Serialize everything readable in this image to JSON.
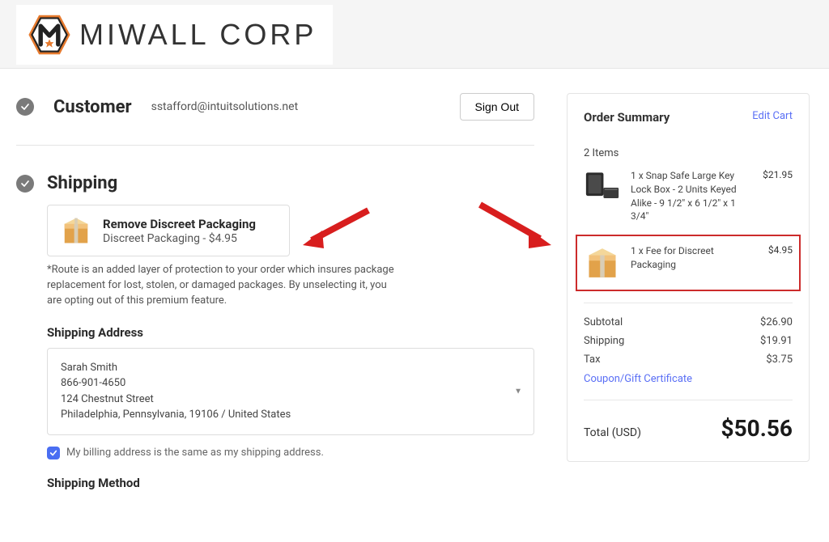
{
  "brand": {
    "name": "MIWALL CORP"
  },
  "customer": {
    "heading": "Customer",
    "email": "sstafford@intuitsolutions.net",
    "signout_label": "Sign Out"
  },
  "shipping": {
    "heading": "Shipping",
    "discreet": {
      "title": "Remove Discreet Packaging",
      "sub": "Discreet Packaging - $4.95"
    },
    "disclaimer": "*Route is an added layer of protection to your order which insures package replacement for lost, stolen, or damaged packages. By unselecting it, you are opting out of this premium feature.",
    "address_heading": "Shipping Address",
    "address": {
      "name": "Sarah Smith",
      "phone": "866-901-4650",
      "street": "124 Chestnut Street",
      "locality": "Philadelphia, Pennsylvania, 19106 / United States"
    },
    "billing_same_label": "My billing address is the same as my shipping address.",
    "method_heading": "Shipping Method"
  },
  "summary": {
    "title": "Order Summary",
    "edit_label": "Edit Cart",
    "items_count_label": "2 Items",
    "items": [
      {
        "name": "1 x Snap Safe Large Key Lock Box - 2 Units Keyed Alike - 9 1/2\" x 6 1/2\" x 1 3/4\"",
        "price": "$21.95"
      },
      {
        "name": "1 x Fee for Discreet Packaging",
        "price": "$4.95"
      }
    ],
    "subtotal_label": "Subtotal",
    "subtotal": "$26.90",
    "shipping_label": "Shipping",
    "shipping": "$19.91",
    "tax_label": "Tax",
    "tax": "$3.75",
    "coupon_label": "Coupon/Gift Certificate",
    "total_label": "Total (USD)",
    "total": "$50.56"
  }
}
